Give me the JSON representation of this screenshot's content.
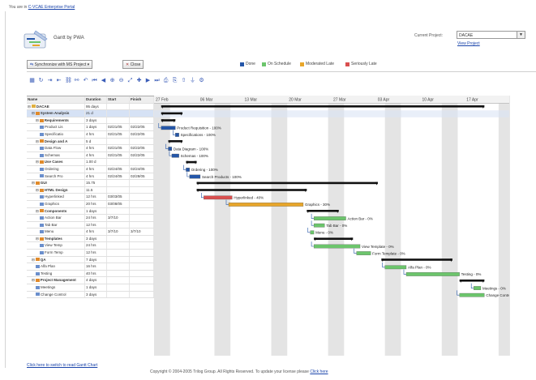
{
  "breadcrumb": {
    "prefix": "You are in",
    "link": "C-VCAE Enterprise Portal"
  },
  "app": {
    "title": "Gantt by PWA"
  },
  "project": {
    "label": "Current Project:",
    "value": "DACAE",
    "link": "View Project"
  },
  "buttons": {
    "synchronize": "Synchronize with MS Project",
    "close": "Close"
  },
  "legend": [
    {
      "label": "Done",
      "color": "#2456a8"
    },
    {
      "label": "On Schedule",
      "color": "#6cc56c"
    },
    {
      "label": "Moderated Late",
      "color": "#e8a62a"
    },
    {
      "label": "Seriously Late",
      "color": "#d94f4f"
    }
  ],
  "toolbar_icons": [
    "grid-icon",
    "refresh-icon",
    "indent-icon",
    "outdent-icon",
    "link-icon",
    "unlink-icon",
    "undo-icon",
    "first-icon",
    "prev-icon",
    "zoom-in-icon",
    "zoom-out-icon",
    "fit-icon",
    "add-icon",
    "next-icon",
    "last-icon",
    "print-icon",
    "export-icon",
    "up-icon",
    "filter-icon",
    "settings-icon"
  ],
  "grid": {
    "columns": [
      "Name",
      "Duration",
      "Start",
      "Finish"
    ],
    "rows": [
      {
        "name": "DACAE",
        "dur": "95 days",
        "start": "",
        "finish": "",
        "level": 0,
        "kind": "root"
      },
      {
        "name": "System Analysis",
        "dur": "21 d",
        "start": "",
        "finish": "",
        "level": 1,
        "kind": "sum"
      },
      {
        "name": "Requirements",
        "dur": "3 days",
        "start": "",
        "finish": "",
        "level": 2,
        "kind": "sum"
      },
      {
        "name": "Product Lis",
        "dur": "1 days",
        "start": "02/21/05",
        "finish": "02/22/05",
        "level": 3,
        "kind": "task"
      },
      {
        "name": "Specificatio",
        "dur": "4 hrs",
        "start": "02/21/05",
        "finish": "02/22/05",
        "level": 3,
        "kind": "task"
      },
      {
        "name": "Design and A",
        "dur": "5 d",
        "start": "",
        "finish": "",
        "level": 2,
        "kind": "sum"
      },
      {
        "name": "Data Flow",
        "dur": "4 hrs",
        "start": "02/21/05",
        "finish": "02/22/05",
        "level": 3,
        "kind": "task"
      },
      {
        "name": "Schemas",
        "dur": "4 hrs",
        "start": "02/21/05",
        "finish": "02/22/05",
        "level": 3,
        "kind": "task"
      },
      {
        "name": "Use Cases",
        "dur": "1.00 d",
        "start": "",
        "finish": "",
        "level": 2,
        "kind": "sum"
      },
      {
        "name": "Ordering",
        "dur": "4 hrs",
        "start": "02/24/05",
        "finish": "02/24/05",
        "level": 3,
        "kind": "task"
      },
      {
        "name": "Search Pro",
        "dur": "4 hrs",
        "start": "02/24/05",
        "finish": "02/28/05",
        "level": 3,
        "kind": "task"
      },
      {
        "name": "GUI",
        "dur": "15.75",
        "start": "",
        "finish": "",
        "level": 1,
        "kind": "sum"
      },
      {
        "name": "HTML Design",
        "dur": "11.5",
        "start": "",
        "finish": "",
        "level": 2,
        "kind": "sum"
      },
      {
        "name": "Hyperlinked",
        "dur": "12 hrs",
        "start": "03/03/05",
        "finish": "",
        "level": 3,
        "kind": "task"
      },
      {
        "name": "Graphics",
        "dur": "20 hrs",
        "start": "03/08/05",
        "finish": "",
        "level": 3,
        "kind": "task"
      },
      {
        "name": "Components",
        "dur": "1 days",
        "start": "",
        "finish": "",
        "level": 2,
        "kind": "sum"
      },
      {
        "name": "Action Bar",
        "dur": "24 hrs",
        "start": "3/7/10",
        "finish": "",
        "level": 3,
        "kind": "task"
      },
      {
        "name": "Tab Bar",
        "dur": "12 hrs",
        "start": "",
        "finish": "",
        "level": 3,
        "kind": "task"
      },
      {
        "name": "Menu",
        "dur": "4 hrs",
        "start": "3/7/10",
        "finish": "3/7/10",
        "level": 3,
        "kind": "task"
      },
      {
        "name": "Templates",
        "dur": "3 days",
        "start": "",
        "finish": "",
        "level": 2,
        "kind": "sum"
      },
      {
        "name": "View Temp",
        "dur": "24 hrs",
        "start": "",
        "finish": "",
        "level": 3,
        "kind": "task"
      },
      {
        "name": "Form Temp",
        "dur": "12 hrs",
        "start": "",
        "finish": "",
        "level": 3,
        "kind": "task"
      },
      {
        "name": "QA",
        "dur": "7 days",
        "start": "",
        "finish": "",
        "level": 1,
        "kind": "sum"
      },
      {
        "name": "Alfa Plan",
        "dur": "16 hrs",
        "start": "",
        "finish": "",
        "level": 2,
        "kind": "task"
      },
      {
        "name": "Testing",
        "dur": "40 hrs",
        "start": "",
        "finish": "",
        "level": 2,
        "kind": "task"
      },
      {
        "name": "Project Management",
        "dur": "4 days",
        "start": "",
        "finish": "",
        "level": 1,
        "kind": "sum"
      },
      {
        "name": "Meetings",
        "dur": "1 days",
        "start": "",
        "finish": "",
        "level": 2,
        "kind": "task"
      },
      {
        "name": "Change Control",
        "dur": "3 days",
        "start": "",
        "finish": "",
        "level": 2,
        "kind": "task"
      }
    ]
  },
  "timescale": [
    "27 Feb",
    "06 Mar",
    "13 Mar",
    "20 Mar",
    "27 Mar",
    "03 Apr",
    "10 Apr",
    "17 Apr"
  ],
  "gantt": {
    "summaries": [
      {
        "row": 0,
        "start": 0.02,
        "end": 0.93
      },
      {
        "row": 1,
        "start": 0.02,
        "end": 0.08
      },
      {
        "row": 2,
        "start": 0.02,
        "end": 0.06
      },
      {
        "row": 5,
        "start": 0.04,
        "end": 0.08
      },
      {
        "row": 8,
        "start": 0.09,
        "end": 0.12
      },
      {
        "row": 11,
        "start": 0.12,
        "end": 0.63
      },
      {
        "row": 12,
        "start": 0.12,
        "end": 0.43
      },
      {
        "row": 15,
        "start": 0.43,
        "end": 0.52
      },
      {
        "row": 19,
        "start": 0.45,
        "end": 0.56
      },
      {
        "row": 22,
        "start": 0.64,
        "end": 0.84
      },
      {
        "row": 25,
        "start": 0.86,
        "end": 0.93
      }
    ],
    "tasks": [
      {
        "row": 3,
        "start": 0.02,
        "end": 0.06,
        "color": "#2456a8",
        "label": "Product Requisition - 100%"
      },
      {
        "row": 4,
        "start": 0.06,
        "end": 0.07,
        "color": "#2456a8",
        "label": "Specifications - 100%"
      },
      {
        "row": 6,
        "start": 0.04,
        "end": 0.05,
        "color": "#2456a8",
        "label": "Data Diagram - 100%"
      },
      {
        "row": 7,
        "start": 0.05,
        "end": 0.07,
        "color": "#2456a8",
        "label": "Schemas - 100%"
      },
      {
        "row": 9,
        "start": 0.09,
        "end": 0.1,
        "color": "#2456a8",
        "label": "Ordering - 100%"
      },
      {
        "row": 10,
        "start": 0.1,
        "end": 0.13,
        "color": "#2456a8",
        "label": "Search Products - 100%"
      },
      {
        "row": 13,
        "start": 0.14,
        "end": 0.22,
        "color": "#d94f4f",
        "label": "Hyperlinked - 40%"
      },
      {
        "row": 14,
        "start": 0.21,
        "end": 0.42,
        "color": "#e8a62a",
        "label": "Graphics - 30%"
      },
      {
        "row": 16,
        "start": 0.45,
        "end": 0.54,
        "color": "#6cc56c",
        "label": "Action Bar - 0%"
      },
      {
        "row": 17,
        "start": 0.45,
        "end": 0.48,
        "color": "#6cc56c",
        "label": "Tab Bar - 0%"
      },
      {
        "row": 18,
        "start": 0.44,
        "end": 0.45,
        "color": "#6cc56c",
        "label": "Menu - 0%"
      },
      {
        "row": 20,
        "start": 0.45,
        "end": 0.58,
        "color": "#6cc56c",
        "label": "View Template - 0%"
      },
      {
        "row": 21,
        "start": 0.57,
        "end": 0.61,
        "color": "#6cc56c",
        "label": "Form Template - 0%"
      },
      {
        "row": 23,
        "start": 0.65,
        "end": 0.71,
        "color": "#6cc56c",
        "label": "Alfa Plan - 0%"
      },
      {
        "row": 24,
        "start": 0.71,
        "end": 0.86,
        "color": "#6cc56c",
        "label": "Testing - 0%"
      },
      {
        "row": 26,
        "start": 0.9,
        "end": 0.92,
        "color": "#6cc56c",
        "label": "Meetings - 0%"
      },
      {
        "row": 27,
        "start": 0.86,
        "end": 0.93,
        "color": "#6cc56c",
        "label": "Change Control - 0%"
      }
    ]
  },
  "footer": {
    "link": "Click here to switch to read Gantt Chart",
    "copyright": "Copyright © 2004-2005 Trilog Group. All Rights Reserved. To update your license please",
    "copyright_link": "Click here"
  }
}
